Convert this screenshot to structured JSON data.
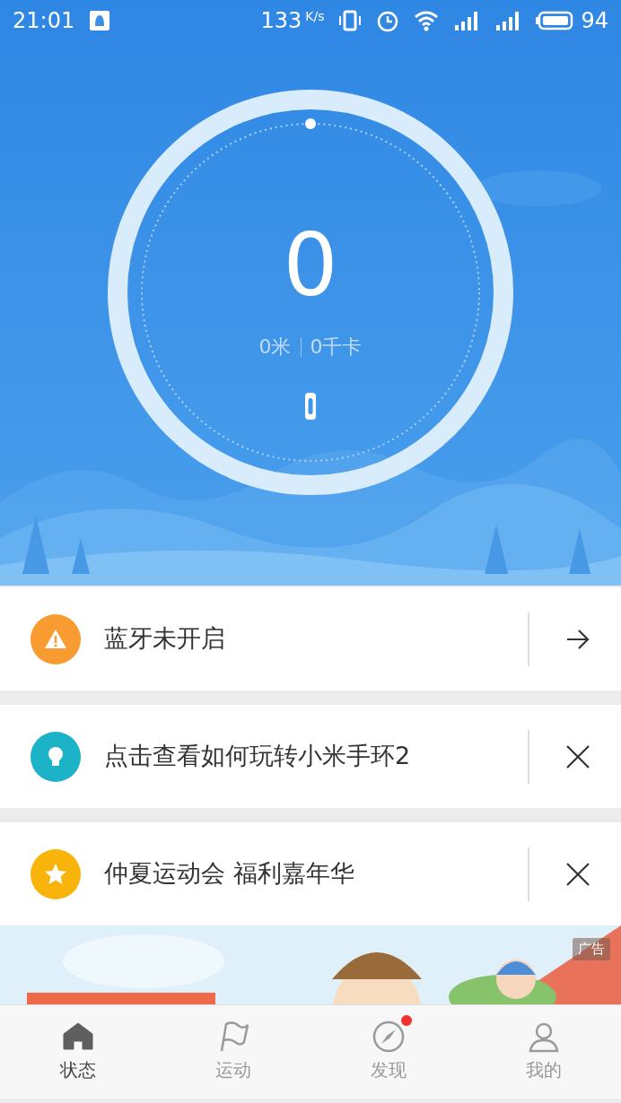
{
  "status_bar": {
    "time": "21:01",
    "speed": "133",
    "speed_unit": "K/s",
    "battery": "94"
  },
  "summary": {
    "steps": "0",
    "distance": "0米",
    "calories": "0千卡"
  },
  "notices": [
    {
      "kind": "warning",
      "color": "#f89b31",
      "text": "蓝牙未开启",
      "action": {
        "kind": "arrow"
      }
    },
    {
      "kind": "bulb",
      "color": "#1cb2c8",
      "text": "点击查看如何玩转小米手环2",
      "action": {
        "kind": "close"
      }
    },
    {
      "kind": "star",
      "color": "#f8b40a",
      "text": "仲夏运动会 福利嘉年华",
      "action": {
        "kind": "close"
      }
    }
  ],
  "ad": {
    "kind": "picture",
    "tag": "广告"
  },
  "tabs": [
    {
      "kind": "home",
      "label": "状态",
      "selected": true,
      "badge": false
    },
    {
      "kind": "flag",
      "label": "运动",
      "selected": false,
      "badge": false
    },
    {
      "kind": "compass",
      "label": "发现",
      "selected": false,
      "badge": true
    },
    {
      "kind": "person",
      "label": "我的",
      "selected": false,
      "badge": false
    }
  ]
}
